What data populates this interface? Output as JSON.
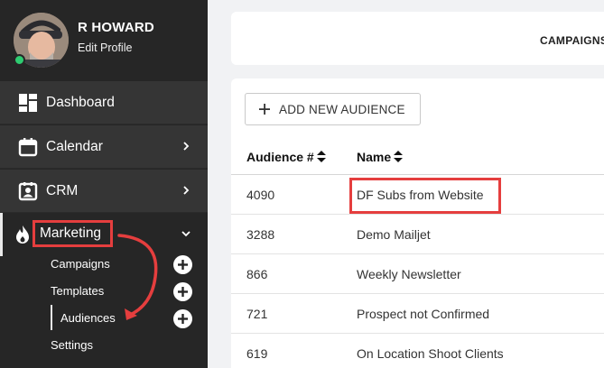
{
  "profile": {
    "user_name": "R HOWARD",
    "edit_profile": "Edit Profile",
    "status_color": "#2ecc71"
  },
  "sidebar": {
    "items": [
      {
        "label": "Dashboard",
        "icon": "dashboard-icon"
      },
      {
        "label": "Calendar",
        "icon": "calendar-icon",
        "has_chevron": true
      },
      {
        "label": "CRM",
        "icon": "contact-card-icon",
        "has_chevron": true
      },
      {
        "label": "Marketing",
        "icon": "flame-icon",
        "expanded": true
      }
    ],
    "marketing_sub": [
      {
        "label": "Campaigns",
        "has_add": true
      },
      {
        "label": "Templates",
        "has_add": true
      },
      {
        "label": "Audiences",
        "has_add": true,
        "active": true
      },
      {
        "label": "Settings",
        "has_add": false
      }
    ]
  },
  "topbar": {
    "label": "CAMPAIGNS"
  },
  "audiences": {
    "add_button_label": "ADD NEW AUDIENCE",
    "columns": [
      "Audience #",
      "Name"
    ],
    "rows": [
      {
        "number": "4090",
        "name": "DF Subs from Website"
      },
      {
        "number": "3288",
        "name": "Demo Mailjet"
      },
      {
        "number": "866",
        "name": "Weekly Newsletter"
      },
      {
        "number": "721",
        "name": "Prospect not Confirmed"
      },
      {
        "number": "619",
        "name": "On Location Shoot Clients"
      }
    ]
  },
  "colors": {
    "sidebar_bg": "#262626",
    "nav_item_bg": "#353535",
    "highlight": "#e53e3e"
  }
}
